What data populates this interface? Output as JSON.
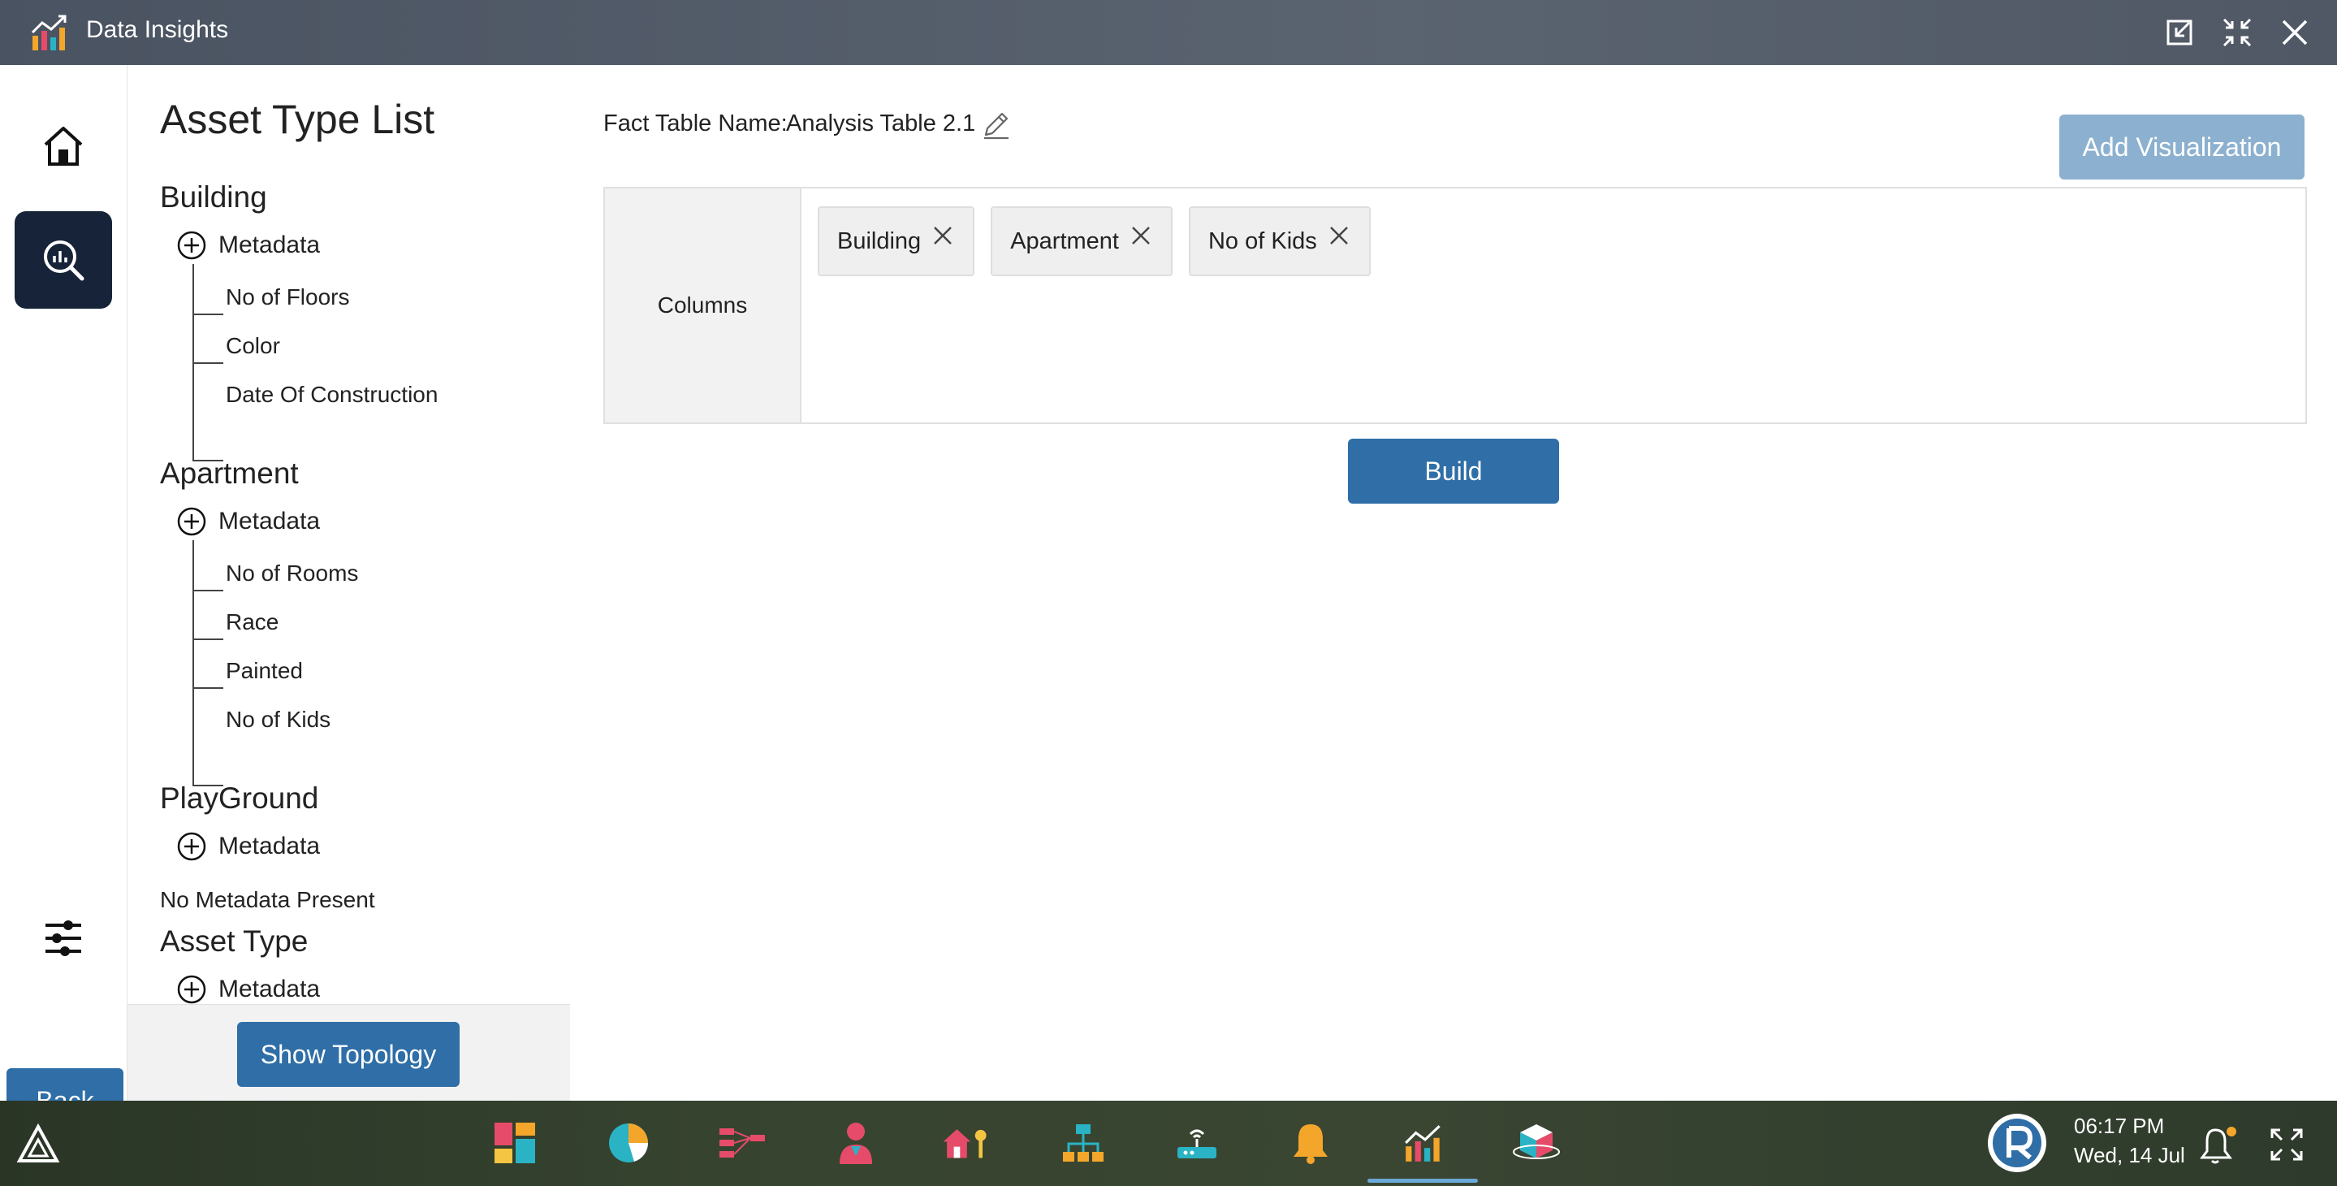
{
  "window": {
    "title": "Data Insights"
  },
  "nav": {
    "back_label": "Back"
  },
  "asset_panel": {
    "title": "Asset Type List",
    "groups": [
      {
        "name": "Building",
        "metadata_label": "Metadata",
        "fields": [
          "No of Floors",
          "Color",
          "Date Of Construction"
        ]
      },
      {
        "name": "Apartment",
        "metadata_label": "Metadata",
        "fields": [
          "No of Rooms",
          "Race",
          "Painted",
          "No of Kids"
        ]
      },
      {
        "name": "PlayGround",
        "metadata_label": "Metadata",
        "note": "No Metadata Present"
      },
      {
        "name": "Asset Type",
        "metadata_label": "Metadata"
      }
    ],
    "show_topology_label": "Show Topology"
  },
  "main": {
    "fact_table_label": "Fact Table Name:",
    "fact_table_name": "Analysis Table 2.1",
    "add_visualization_label": "Add Visualization",
    "columns_label": "Columns",
    "chips": [
      "Building",
      "Apartment",
      "No of Kids"
    ],
    "build_label": "Build"
  },
  "taskbar": {
    "time": "06:17 PM",
    "date": "Wed, 14 Jul",
    "apps": [
      "dashboard-app-icon",
      "pie-chart-app-icon",
      "flow-app-icon",
      "user-app-icon",
      "home-key-app-icon",
      "hierarchy-app-icon",
      "router-app-icon",
      "bell-app-icon",
      "data-insights-app-icon",
      "cube-app-icon"
    ]
  },
  "colors": {
    "primary_button": "#2f6ea6",
    "disabled_button": "#8cb0cf",
    "nav_active": "#172339",
    "titlebar": "#4a5361"
  }
}
